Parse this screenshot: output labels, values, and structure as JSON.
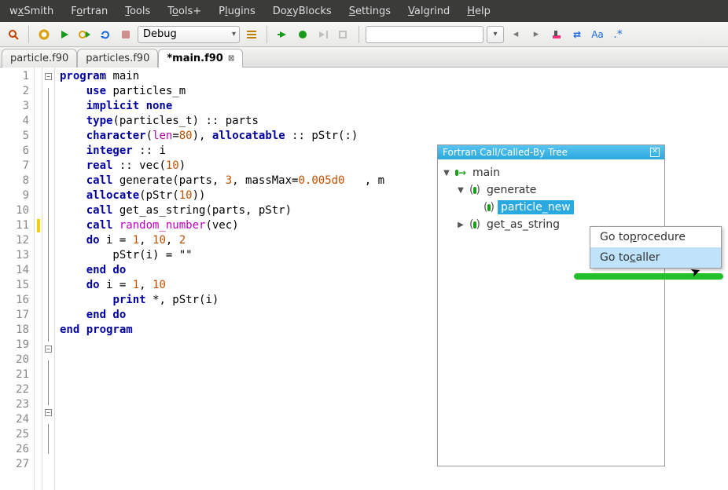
{
  "menubar": [
    "w_xSmith",
    "F_ortran",
    "_Tools",
    "T_ools+",
    "P_lugins",
    "Do_xyBlocks",
    "_Settings",
    "_Valgrind",
    "_Help"
  ],
  "toolbar": {
    "config_combo": "Debug",
    "search_value": ""
  },
  "tabs": [
    {
      "label": "particle.f90",
      "active": false,
      "close": false
    },
    {
      "label": "particles.f90",
      "active": false,
      "close": false
    },
    {
      "label": "*main.f90",
      "active": true,
      "close": true
    }
  ],
  "gutter_lines": [
    "1",
    "2",
    "3",
    "4",
    "5",
    "6",
    "7",
    "8",
    "9",
    "10",
    "11",
    "12",
    "13",
    "14",
    "15",
    "16",
    "17",
    "18",
    "19",
    "20",
    "21",
    "22",
    "23",
    "24",
    "25",
    "26",
    "27"
  ],
  "gutter_marks": {
    "11": "#f4d000"
  },
  "fold": {
    "1": "minus",
    "19": "minus",
    "23": "minus"
  },
  "panel": {
    "title": "Fortran Call/Called-By Tree",
    "tree": [
      {
        "depth": 0,
        "expand": "open",
        "icon": "arrow",
        "label": "main",
        "sel": false
      },
      {
        "depth": 1,
        "expand": "open",
        "icon": "box",
        "label": "generate",
        "sel": false
      },
      {
        "depth": 2,
        "expand": "none",
        "icon": "box",
        "label": "particle_new",
        "sel": true
      },
      {
        "depth": 1,
        "expand": "closed",
        "icon": "box",
        "label": "get_as_string",
        "sel": false
      }
    ]
  },
  "context_menu": [
    {
      "label": "Go to procedure",
      "ul": "p",
      "hover": false
    },
    {
      "label": "Go to caller",
      "ul": "c",
      "hover": true
    }
  ],
  "code_tokens": [
    [
      [
        "k-blue",
        "program"
      ],
      [
        "",
        " main"
      ]
    ],
    [
      [
        "",
        "    "
      ],
      [
        "k-blue",
        "use"
      ],
      [
        "",
        " particles_m"
      ]
    ],
    [
      [
        "",
        "    "
      ],
      [
        "k-blue",
        "implicit none"
      ]
    ],
    [
      [
        "",
        ""
      ]
    ],
    [
      [
        "",
        "    "
      ],
      [
        "k-blue",
        "type"
      ],
      [
        "",
        "(particles_t) :: parts"
      ]
    ],
    [
      [
        "",
        "    "
      ],
      [
        "k-blue",
        "character"
      ],
      [
        "",
        "("
      ],
      [
        "k-mag",
        "len"
      ],
      [
        "",
        "="
      ],
      [
        "k-num",
        "80"
      ],
      [
        "",
        "), "
      ],
      [
        "k-blue",
        "allocatable"
      ],
      [
        "",
        " :: pStr(:)"
      ]
    ],
    [
      [
        "",
        "    "
      ],
      [
        "k-blue",
        "integer"
      ],
      [
        "",
        " :: i"
      ]
    ],
    [
      [
        "",
        ""
      ]
    ],
    [
      [
        "",
        "    "
      ],
      [
        "k-blue",
        "real"
      ],
      [
        "",
        " :: vec("
      ],
      [
        "k-num",
        "10"
      ],
      [
        "",
        ")"
      ]
    ],
    [
      [
        "",
        ""
      ]
    ],
    [
      [
        "",
        "    "
      ],
      [
        "k-blue",
        "call"
      ],
      [
        "",
        " generate(parts, "
      ],
      [
        "k-num",
        "3"
      ],
      [
        "",
        ", massMax="
      ],
      [
        "k-num",
        "0.005d0"
      ],
      [
        "",
        "   , m"
      ]
    ],
    [
      [
        "",
        ""
      ]
    ],
    [
      [
        "",
        "    "
      ],
      [
        "k-blue",
        "allocate"
      ],
      [
        "",
        "(pStr("
      ],
      [
        "k-num",
        "10"
      ],
      [
        "",
        "))"
      ]
    ],
    [
      [
        "",
        "    "
      ],
      [
        "k-blue",
        "call"
      ],
      [
        "",
        " get_as_string(parts, pStr)"
      ]
    ],
    [
      [
        "",
        ""
      ]
    ],
    [
      [
        "",
        "    "
      ],
      [
        "k-blue",
        "call"
      ],
      [
        "",
        " "
      ],
      [
        "k-mag2",
        "random_number"
      ],
      [
        "",
        "(vec)"
      ]
    ],
    [
      [
        "",
        ""
      ]
    ],
    [
      [
        "",
        ""
      ]
    ],
    [
      [
        "",
        "    "
      ],
      [
        "k-blue",
        "do"
      ],
      [
        "",
        " i = "
      ],
      [
        "k-num",
        "1"
      ],
      [
        "",
        ", "
      ],
      [
        "k-num",
        "10"
      ],
      [
        "",
        ", "
      ],
      [
        "k-num",
        "2"
      ]
    ],
    [
      [
        "",
        "        pStr(i) = \"\""
      ]
    ],
    [
      [
        "",
        "    "
      ],
      [
        "k-blue",
        "end do"
      ]
    ],
    [
      [
        "",
        ""
      ]
    ],
    [
      [
        "",
        "    "
      ],
      [
        "k-blue",
        "do"
      ],
      [
        "",
        " i = "
      ],
      [
        "k-num",
        "1"
      ],
      [
        "",
        ", "
      ],
      [
        "k-num",
        "10"
      ]
    ],
    [
      [
        "",
        "        "
      ],
      [
        "k-blue",
        "print"
      ],
      [
        "",
        " *, pStr(i)"
      ]
    ],
    [
      [
        "",
        "    "
      ],
      [
        "k-blue",
        "end do"
      ]
    ],
    [
      [
        "k-blue",
        "end program"
      ]
    ],
    [
      [
        "",
        ""
      ]
    ]
  ]
}
